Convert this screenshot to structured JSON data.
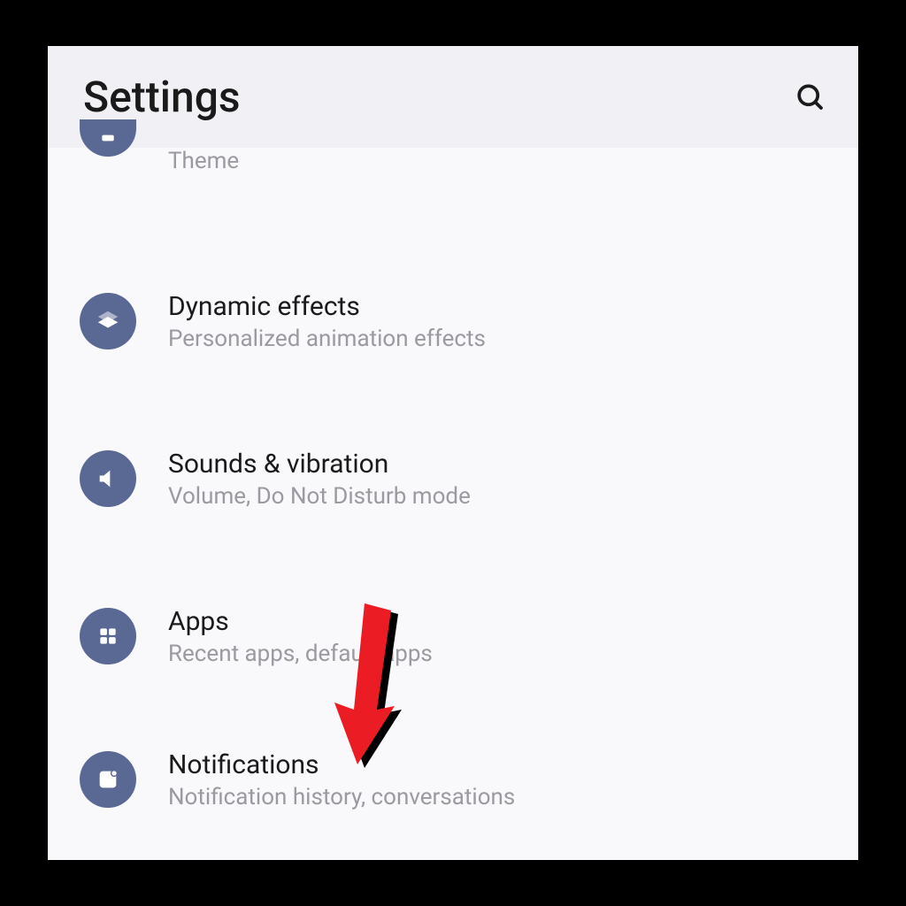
{
  "header": {
    "title": "Settings"
  },
  "items": [
    {
      "title": "",
      "subtitle": "Theme",
      "icon": "theme-icon",
      "partial": true
    },
    {
      "title": "Dynamic effects",
      "subtitle": "Personalized animation effects",
      "icon": "layers-icon"
    },
    {
      "title": "Sounds & vibration",
      "subtitle": "Volume, Do Not Disturb mode",
      "icon": "volume-icon"
    },
    {
      "title": "Apps",
      "subtitle": "Recent apps, default apps",
      "icon": "apps-icon"
    },
    {
      "title": "Notifications",
      "subtitle": "Notification history, conversations",
      "icon": "notification-icon"
    }
  ],
  "colors": {
    "icon_bg": "#5a6894",
    "arrow": "#ec1c24"
  }
}
